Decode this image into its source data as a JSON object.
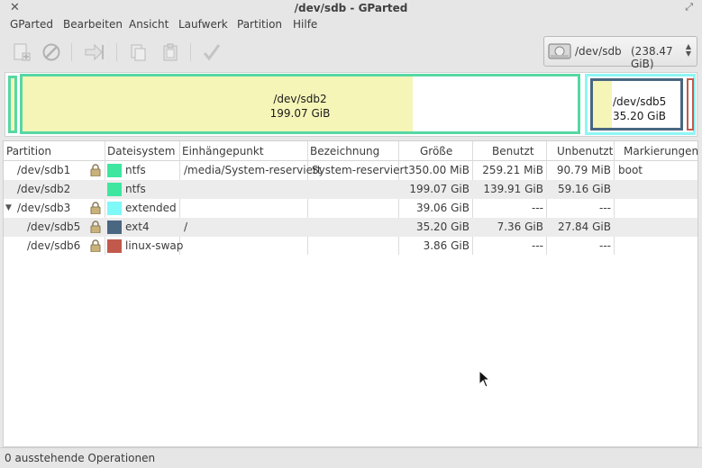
{
  "window": {
    "title": "/dev/sdb - GParted",
    "close_glyph": "✕",
    "maximize_glyph": "⤢"
  },
  "menu": [
    "GParted",
    "Bearbeiten",
    "Ansicht",
    "Laufwerk",
    "Partition",
    "Hilfe"
  ],
  "toolbar": {
    "buttons": [
      "new-icon",
      "delete-icon",
      "resize-move-icon",
      "copy-icon",
      "paste-icon",
      "apply-icon"
    ]
  },
  "device_selector": {
    "device": "/dev/sdb",
    "size": "(238.47 GiB)"
  },
  "diskmap": {
    "sdb2": {
      "name": "/dev/sdb2",
      "size": "199.07 GiB"
    },
    "sdb5": {
      "name": "/dev/sdb5",
      "size": "35.20 GiB"
    }
  },
  "table": {
    "columns": [
      "Partition",
      "Dateisystem",
      "Einhängepunkt",
      "Bezeichnung",
      "Größe",
      "Benutzt",
      "Unbenutzt",
      "Markierungen"
    ],
    "rows": [
      {
        "partition": "/dev/sdb1",
        "fs": "ntfs",
        "fs_color": "#3ee6a0",
        "mount": "/media/System-reserviert",
        "label": "System-reserviert",
        "size": "350.00 MiB",
        "used": "259.21 MiB",
        "unused": "90.79 MiB",
        "flags": "boot",
        "locked": true
      },
      {
        "partition": "/dev/sdb2",
        "fs": "ntfs",
        "fs_color": "#3ee6a0",
        "mount": "",
        "label": "",
        "size": "199.07 GiB",
        "used": "139.91 GiB",
        "unused": "59.16 GiB",
        "flags": "",
        "locked": false
      },
      {
        "partition": "/dev/sdb3",
        "fs": "extended",
        "fs_color": "#7ff8f8",
        "mount": "",
        "label": "",
        "size": "39.06 GiB",
        "used": "---",
        "unused": "---",
        "flags": "",
        "locked": true,
        "expander": "▼"
      },
      {
        "partition": "/dev/sdb5",
        "fs": "ext4",
        "fs_color": "#4a6781",
        "mount": "/",
        "label": "",
        "size": "35.20 GiB",
        "used": "7.36 GiB",
        "unused": "27.84 GiB",
        "flags": "",
        "locked": true
      },
      {
        "partition": "/dev/sdb6",
        "fs": "linux-swap",
        "fs_color": "#c15a4c",
        "mount": "",
        "label": "",
        "size": "3.86 GiB",
        "used": "---",
        "unused": "---",
        "flags": "",
        "locked": true
      }
    ]
  },
  "status": {
    "text": "0 ausstehende Operationen"
  }
}
